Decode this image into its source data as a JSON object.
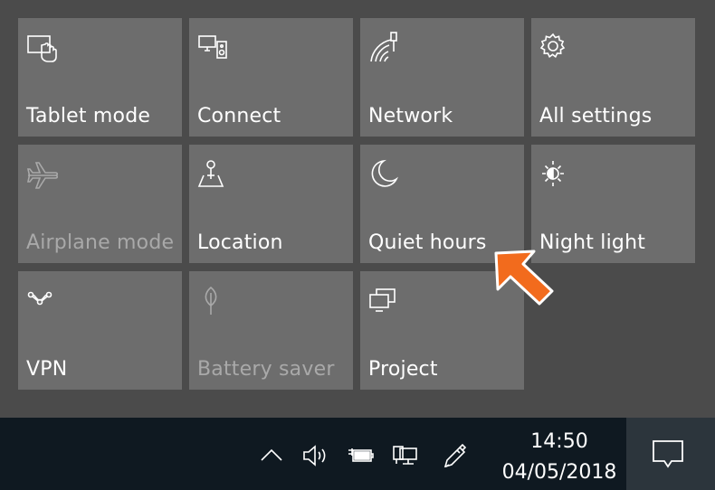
{
  "quick_actions": {
    "tiles": [
      {
        "label": "Tablet mode",
        "icon": "tablet-mode-icon",
        "enabled": true
      },
      {
        "label": "Connect",
        "icon": "connect-icon",
        "enabled": true
      },
      {
        "label": "Network",
        "icon": "network-icon",
        "enabled": true
      },
      {
        "label": "All settings",
        "icon": "gear-icon",
        "enabled": true
      },
      {
        "label": "Airplane mode",
        "icon": "airplane-icon",
        "enabled": false
      },
      {
        "label": "Location",
        "icon": "location-icon",
        "enabled": true
      },
      {
        "label": "Quiet hours",
        "icon": "moon-icon",
        "enabled": true
      },
      {
        "label": "Night light",
        "icon": "sun-icon",
        "enabled": true
      },
      {
        "label": "VPN",
        "icon": "vpn-icon",
        "enabled": true
      },
      {
        "label": "Battery saver",
        "icon": "leaf-icon",
        "enabled": false
      },
      {
        "label": "Project",
        "icon": "project-icon",
        "enabled": true
      }
    ]
  },
  "taskbar": {
    "clock": {
      "time": "14:50",
      "date": "04/05/2018"
    },
    "tray_icons": [
      "chevron-up-icon",
      "volume-icon",
      "battery-plugged-icon",
      "network-wired-icon",
      "pen-icon"
    ],
    "action_center_icon": "notification-icon"
  },
  "colors": {
    "tile": "#6d6d6d",
    "background": "#4b4b4b",
    "taskbar": "#0f1921",
    "highlight_arrow": "#f26b1d",
    "disabled_text": "#a9a9a9"
  }
}
